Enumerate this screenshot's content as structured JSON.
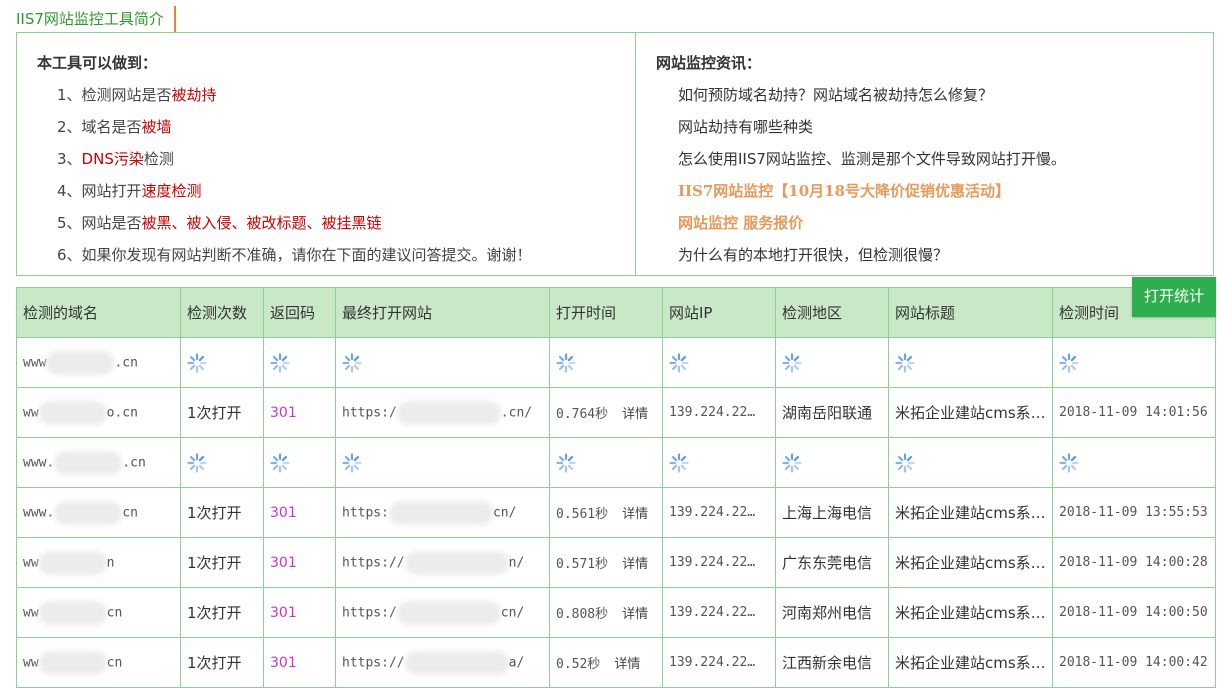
{
  "section_title": "IIS7网站监控工具简介",
  "intro": {
    "left_heading": "本工具可以做到：",
    "features": [
      {
        "parts": [
          {
            "t": "1、检测网站是否",
            "h": false
          },
          {
            "t": "被劫持",
            "h": true
          }
        ]
      },
      {
        "parts": [
          {
            "t": "2、域名是否",
            "h": false
          },
          {
            "t": "被墙",
            "h": true
          }
        ]
      },
      {
        "parts": [
          {
            "t": "3、",
            "h": false
          },
          {
            "t": "DNS污染",
            "h": true
          },
          {
            "t": "检测",
            "h": false
          }
        ]
      },
      {
        "parts": [
          {
            "t": "4、网站打开",
            "h": false
          },
          {
            "t": "速度检测",
            "h": true
          }
        ]
      },
      {
        "parts": [
          {
            "t": "5、网站是否",
            "h": false
          },
          {
            "t": "被黑、被入侵、被改标题、被挂黑链",
            "h": true
          }
        ]
      },
      {
        "parts": [
          {
            "t": "6、如果你发现有网站判断不准确，请你在下面的建议问答提交。谢谢！",
            "h": false
          }
        ]
      }
    ],
    "right_heading": "网站监控资讯：",
    "news": [
      {
        "text": "如何预防域名劫持？网站域名被劫持怎么修复？",
        "promo": false
      },
      {
        "text": "网站劫持有哪些种类",
        "promo": false
      },
      {
        "text": "怎么使用IIS7网站监控、监测是那个文件导致网站打开慢。",
        "promo": false
      },
      {
        "text": "IIS7网站监控【10月18号大降价促销优惠活动】",
        "promo": true
      },
      {
        "text": "网站监控  服务报价",
        "promo": true
      },
      {
        "text": "为什么有的本地打开很快，但检测很慢？",
        "promo": false
      }
    ]
  },
  "stats_button": "打开统计",
  "table": {
    "headers": [
      "检测的域名",
      "检测次数",
      "返回码",
      "最终打开网站",
      "打开时间",
      "网站IP",
      "检测地区",
      "网站标题",
      "检测时间"
    ],
    "detail_label": "详情",
    "rows": [
      {
        "loading": true,
        "domain_pre": "www",
        "domain_post": ".cn"
      },
      {
        "loading": false,
        "domain_pre": "ww",
        "domain_post": "o.cn",
        "count": "1次打开",
        "code": "301",
        "url_pre": "https:/",
        "url_post": ".cn/",
        "time": "0.764秒",
        "ip": "139.224.22…",
        "region": "湖南岳阳联通",
        "title": "米拓企业建站cms系…",
        "checked": "2018-11-09 14:01:56"
      },
      {
        "loading": true,
        "domain_pre": "www.",
        "domain_post": ".cn"
      },
      {
        "loading": false,
        "domain_pre": "www.",
        "domain_post": "cn",
        "count": "1次打开",
        "code": "301",
        "url_pre": "https:",
        "url_post": "cn/",
        "time": "0.561秒",
        "ip": "139.224.22…",
        "region": "上海上海电信",
        "title": "米拓企业建站cms系…",
        "checked": "2018-11-09 13:55:53"
      },
      {
        "loading": false,
        "domain_pre": "ww",
        "domain_post": "n",
        "count": "1次打开",
        "code": "301",
        "url_pre": "https://",
        "url_post": "n/",
        "time": "0.571秒",
        "ip": "139.224.22…",
        "region": "广东东莞电信",
        "title": "米拓企业建站cms系…",
        "checked": "2018-11-09 14:00:28"
      },
      {
        "loading": false,
        "domain_pre": "ww",
        "domain_post": "cn",
        "count": "1次打开",
        "code": "301",
        "url_pre": "https:/",
        "url_post": "cn/",
        "time": "0.808秒",
        "ip": "139.224.22…",
        "region": "河南郑州电信",
        "title": "米拓企业建站cms系…",
        "checked": "2018-11-09 14:00:50"
      },
      {
        "loading": false,
        "domain_pre": "ww",
        "domain_post": "cn",
        "count": "1次打开",
        "code": "301",
        "url_pre": "https://",
        "url_post": "a/",
        "time": "0.52秒",
        "ip": "139.224.22…",
        "region": "江西新余电信",
        "title": "米拓企业建站cms系…",
        "checked": "2018-11-09 14:00:42"
      }
    ]
  },
  "colors": {
    "accent_green": "#2eae4e",
    "header_bg": "#c8e8c8",
    "highlight_red": "#cc0000",
    "promo_orange": "#e69a5c",
    "code_magenta": "#cc33cc",
    "spinner_blue": "#4a90e2"
  },
  "icons": {
    "loading": "loading-spinner-icon"
  }
}
